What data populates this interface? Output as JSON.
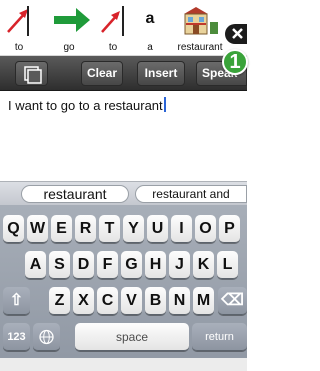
{
  "symbol_strip": {
    "cells": [
      {
        "label": "to",
        "icon": "red-arrow-up-right-icon"
      },
      {
        "label": "go",
        "icon": "green-arrow-right-icon"
      },
      {
        "label": "to",
        "icon": "red-arrow-up-right-icon"
      },
      {
        "label": "a",
        "icon": "letter-a-icon",
        "glyph": "a"
      },
      {
        "label": "restaurant",
        "icon": "restaurant-building-icon"
      }
    ],
    "close_icon": "✕",
    "badge_count": "1"
  },
  "toolbar": {
    "copy_icon": "copy-icon",
    "clear_label": "Clear",
    "insert_label": "Insert",
    "speak_label": "Speak"
  },
  "text_area": {
    "value": "I want to go to a restaurant"
  },
  "suggestions": [
    "restaurant",
    "restaurant and"
  ],
  "keyboard": {
    "row1": [
      "Q",
      "W",
      "E",
      "R",
      "T",
      "Y",
      "U",
      "I",
      "O",
      "P"
    ],
    "row2": [
      "A",
      "S",
      "D",
      "F",
      "G",
      "H",
      "J",
      "K",
      "L"
    ],
    "row3": [
      "Z",
      "X",
      "C",
      "V",
      "B",
      "N",
      "M"
    ],
    "shift_icon": "⇧",
    "delete_icon": "⌫",
    "numbers_label": "123",
    "globe_icon": "globe-icon",
    "space_label": "space",
    "return_label": "return"
  },
  "colors": {
    "arrow_red": "#d8232a",
    "arrow_green": "#1f9b3a",
    "badge_green": "#3aa33a",
    "caret_blue": "#2a64d6"
  }
}
